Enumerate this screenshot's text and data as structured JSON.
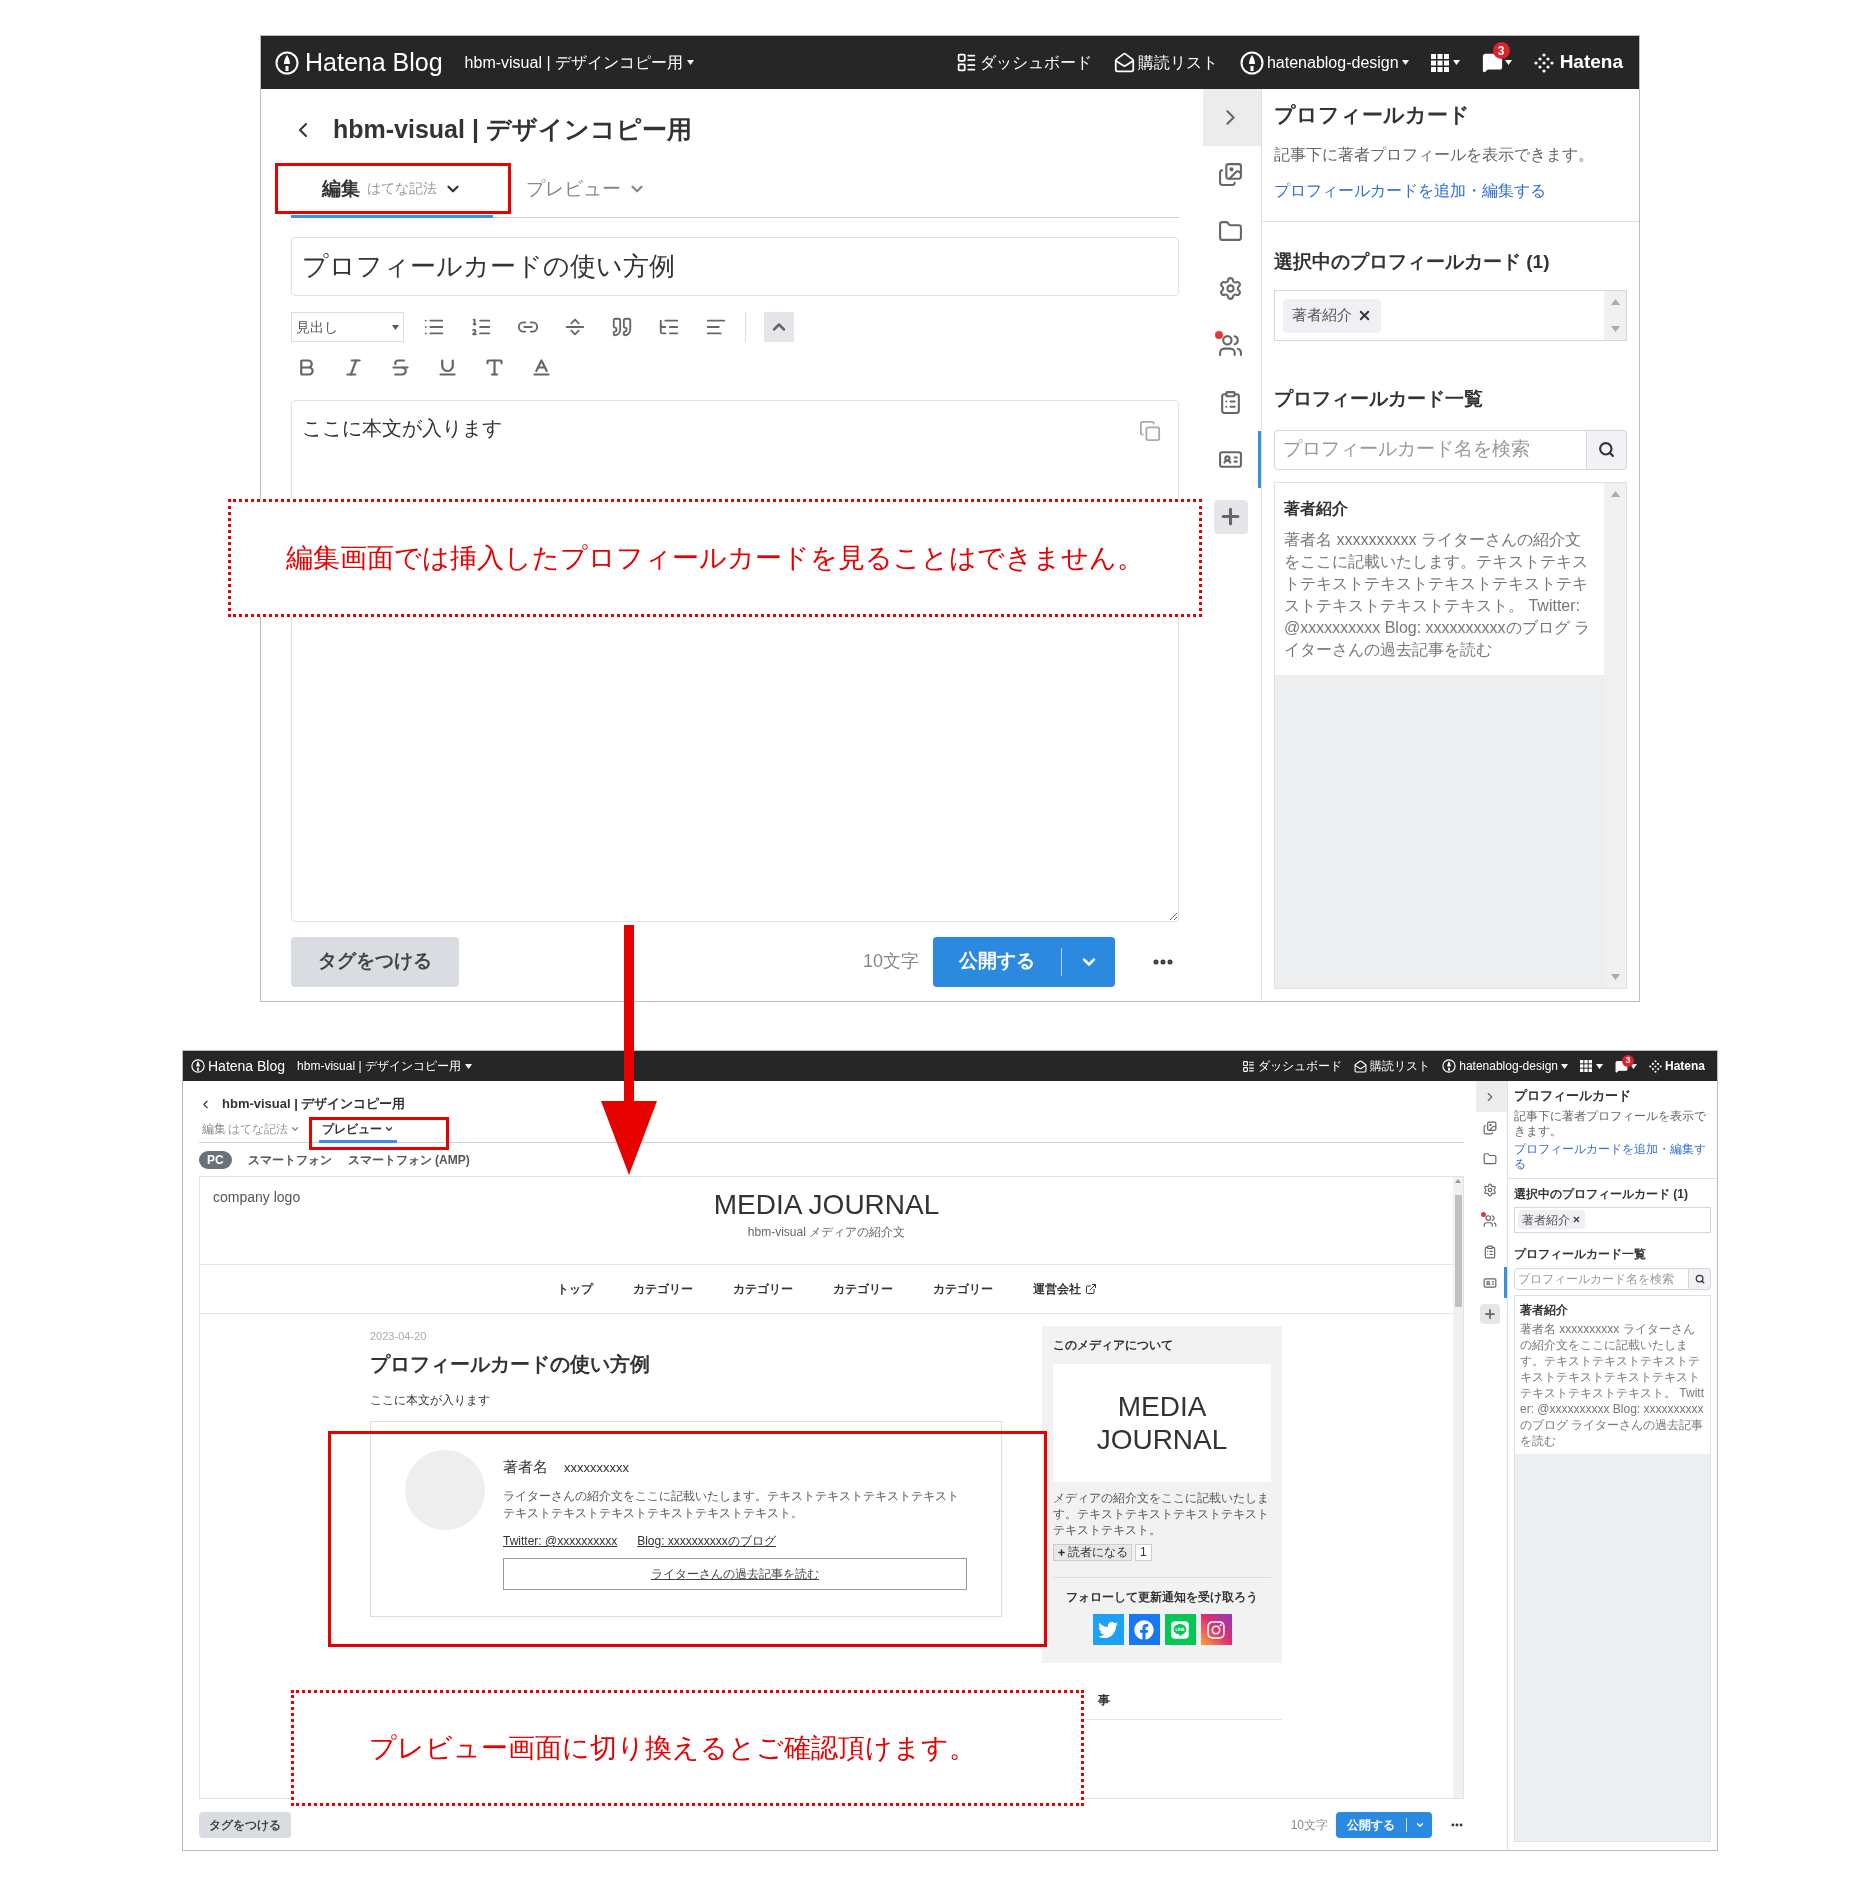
{
  "top": {
    "header": {
      "logo": "Hatena Blog",
      "blog_select": "hbm-visual | デザインコピー用",
      "nav": [
        {
          "kind": "dashboard",
          "label": "ダッシュボード"
        },
        {
          "kind": "subscriptions",
          "label": "購読リスト"
        },
        {
          "kind": "account",
          "label": "hatenablog-design"
        }
      ],
      "notifications": "3",
      "brand": "Hatena"
    },
    "editor": {
      "blog_title": "hbm-visual | デザインコピー用",
      "modes": [
        {
          "label": "編集",
          "note": "はてな記法",
          "selected": true
        },
        {
          "label": "プレビュー",
          "selected": false
        }
      ],
      "title_field": "プロフィールカードの使い方例",
      "heading_select": "見出し",
      "body_field": "ここに本文が入ります",
      "tag_button": "タグをつける",
      "char_count": "10文字",
      "publish_button": "公開する"
    },
    "tools": [
      {
        "kind": "collapse",
        "selected": false,
        "dot": false
      },
      {
        "kind": "images",
        "selected": false,
        "dot": false
      },
      {
        "kind": "folder",
        "selected": false,
        "dot": false
      },
      {
        "kind": "settings",
        "selected": false,
        "dot": false
      },
      {
        "kind": "users",
        "selected": false,
        "dot": true
      },
      {
        "kind": "clipboard",
        "selected": false,
        "dot": false
      },
      {
        "kind": "profile_card",
        "selected": true,
        "dot": false
      },
      {
        "kind": "plus",
        "selected": false,
        "dot": false
      }
    ],
    "panel": {
      "title": "プロフィールカード",
      "description": "記事下に著者プロフィールを表示できます。",
      "edit_link": "プロフィールカードを追加・編集する",
      "selected_heading": "選択中のプロフィールカード (1)",
      "selected_cards": [
        "著者紹介"
      ],
      "list_heading": "プロフィールカード一覧",
      "search_placeholder": "プロフィールカード名を検索",
      "cards": [
        {
          "name": "著者紹介",
          "summary": "著者名 xxxxxxxxxx ライターさんの紹介文をここに記載いたします。テキストテキストテキストテキストテキストテキストテキストテキストテキストテキスト。 Twitter: @xxxxxxxxxx Blog: xxxxxxxxxxのブログ ライターさんの過去記事を読む"
        }
      ]
    }
  },
  "bottom": {
    "header": {
      "logo": "Hatena Blog",
      "blog_select": "hbm-visual | デザインコピー用",
      "nav": [
        {
          "kind": "dashboard",
          "label": "ダッシュボード"
        },
        {
          "kind": "subscriptions",
          "label": "購読リスト"
        },
        {
          "kind": "account",
          "label": "hatenablog-design"
        }
      ],
      "notifications": "3",
      "brand": "Hatena"
    },
    "editor": {
      "blog_title": "hbm-visual | デザインコピー用",
      "modes": [
        {
          "label": "編集",
          "note": "はてな記法",
          "selected": false
        },
        {
          "label": "プレビュー",
          "selected": true
        }
      ],
      "devices": [
        {
          "label": "PC",
          "selected": true
        },
        {
          "label": "スマートフォン",
          "selected": false
        },
        {
          "label": "スマートフォン (AMP)",
          "selected": false
        }
      ],
      "tag_button": "タグをつける",
      "char_count": "10文字",
      "publish_button": "公開する"
    },
    "preview": {
      "logo_text": "company logo",
      "site_title": "MEDIA JOURNAL",
      "site_description": "hbm-visual メディアの紹介文",
      "nav": [
        {
          "label": "トップ",
          "external": false
        },
        {
          "label": "カテゴリー",
          "external": false
        },
        {
          "label": "カテゴリー",
          "external": false
        },
        {
          "label": "カテゴリー",
          "external": false
        },
        {
          "label": "カテゴリー",
          "external": false
        },
        {
          "label": "運営会社",
          "external": true
        }
      ],
      "date": "2023-04-20",
      "title": "プロフィールカードの使い方例",
      "body": "ここに本文が入ります",
      "card": {
        "name_label": "著者名",
        "name": "xxxxxxxxxx",
        "bio": "ライターさんの紹介文をここに記載いたします。テキストテキストテキストテキストテキストテキストテキストテキストテキストテキスト。",
        "links": [
          "Twitter: @xxxxxxxxxx",
          "Blog: xxxxxxxxxxのブログ"
        ],
        "button": "ライターさんの過去記事を読む"
      },
      "sidebar": {
        "about_heading": "このメディアについて",
        "logo_text": "MEDIA JOURNAL",
        "description": "メディアの紹介文をここに記載いたします。テキストテキストテキストテキストテキストテキスト。",
        "subscribe_button": "読者になる",
        "subscriber_count": "1",
        "follow_heading": "フォローして更新通知を受け取ろう",
        "social": [
          {
            "kind": "twitter"
          },
          {
            "kind": "facebook"
          },
          {
            "kind": "line"
          },
          {
            "kind": "instagram"
          }
        ],
        "next_heading": "事"
      }
    },
    "tools": [
      {
        "kind": "collapse",
        "selected": false,
        "dot": false
      },
      {
        "kind": "images",
        "selected": false,
        "dot": false
      },
      {
        "kind": "folder",
        "selected": false,
        "dot": false
      },
      {
        "kind": "settings",
        "selected": false,
        "dot": false
      },
      {
        "kind": "users",
        "selected": false,
        "dot": true
      },
      {
        "kind": "clipboard",
        "selected": false,
        "dot": false
      },
      {
        "kind": "profile_card",
        "selected": true,
        "dot": false
      },
      {
        "kind": "plus",
        "selected": false,
        "dot": false
      }
    ],
    "panel": {
      "title": "プロフィールカード",
      "description": "記事下に著者プロフィールを表示できます。",
      "edit_link": "プロフィールカードを追加・編集する",
      "selected_heading": "選択中のプロフィールカード (1)",
      "selected_cards": [
        "著者紹介"
      ],
      "list_heading": "プロフィールカード一覧",
      "search_placeholder": "プロフィールカード名を検索",
      "cards": [
        {
          "name": "著者紹介",
          "summary": "著者名 xxxxxxxxxx ライターさんの紹介文をここに記載いたします。テキストテキストテキストテキストテキストテキストテキストテキストテキストテキスト。 Twitter: @xxxxxxxxxx Blog: xxxxxxxxxxのブログ ライターさんの過去記事を読む"
        }
      ]
    }
  },
  "annotations": {
    "edit_note": "編集画面では挿入したプロフィールカードを見ることはできません。",
    "preview_note": "プレビュー画面に切り換えるとご確認頂けます。"
  }
}
